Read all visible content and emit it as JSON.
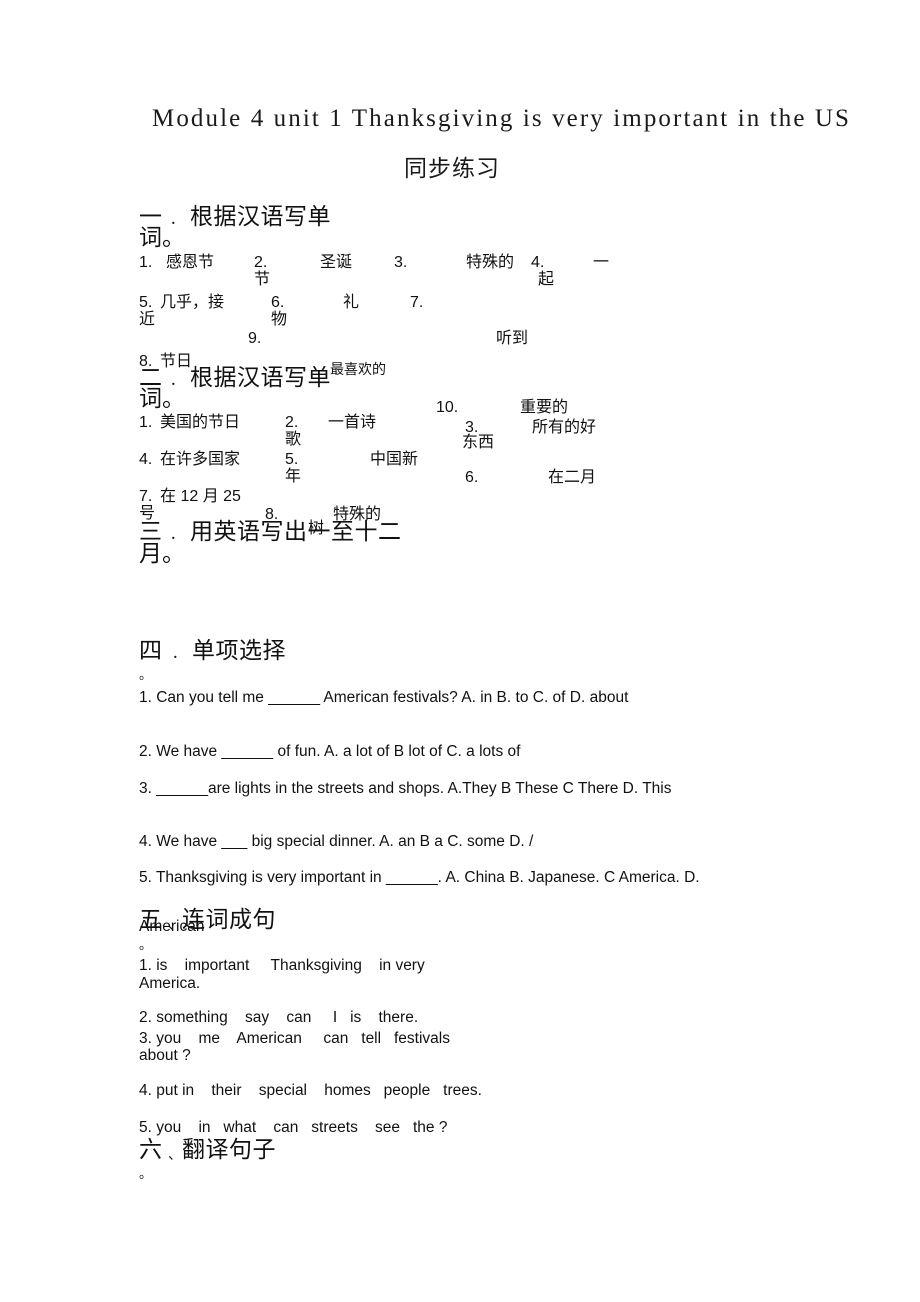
{
  "document": {
    "title": "Module 4 unit 1 Thanksgiving is very important in the US",
    "subtitle": "同步练习"
  },
  "section1": {
    "heading_num": "一",
    "heading_dot": "．",
    "heading_text": "根据汉语写单",
    "heading_wrap": "词。",
    "items": [
      {
        "num": "1.",
        "answer": "感恩节"
      },
      {
        "num": "2.",
        "answer": "圣诞",
        "answer_wrap": "节"
      },
      {
        "num": "3.",
        "answer": "特殊的"
      },
      {
        "num": "4.",
        "answer": "一",
        "answer_wrap": "起"
      },
      {
        "num": "5.",
        "answer": "几乎，接",
        "answer_wrap": "近"
      },
      {
        "num": "6.",
        "answer": "礼",
        "answer_wrap": "物"
      },
      {
        "num": "7.",
        "answer": "听到"
      },
      {
        "num": "8.",
        "answer": "节日"
      },
      {
        "num": "9.",
        "answer": "最喜欢的"
      }
    ]
  },
  "section2": {
    "heading_num": "二",
    "heading_dot": "．",
    "heading_text": "根据汉语写单",
    "heading_wrap": "词。",
    "items": [
      {
        "num": "1.",
        "answer": "美国的节日"
      },
      {
        "num": "2.",
        "answer": "一首诗",
        "answer_wrap": "歌"
      },
      {
        "num": "3.",
        "answer": "所有的好",
        "answer_wrap": "东西"
      },
      {
        "num": "4.",
        "answer": "在许多国家"
      },
      {
        "num": "5.",
        "answer": "中国新",
        "answer_wrap": "年"
      },
      {
        "num": "6.",
        "answer": "在二月"
      },
      {
        "num": "7.",
        "answer": "在 12 月 25",
        "answer_wrap": "号"
      },
      {
        "num": "8.",
        "answer": "特殊的",
        "answer_wrap": "树"
      },
      {
        "num": "10.",
        "answer": "重要的"
      }
    ]
  },
  "section3": {
    "heading_num": "三",
    "heading_dot": "．",
    "heading_text": "用英语写出一至十二",
    "heading_wrap": "月。"
  },
  "section4": {
    "heading_num": "四",
    "heading_dot": "．",
    "heading_text": "单项选择",
    "heading_period": "。",
    "questions": [
      {
        "text": "1.  Can you tell me ______ American festivals? A. in      B. to    C. of    D. about"
      },
      {
        "text": "2. We have ______ of fun. A. a lot of     B lot of    C. a lots of"
      },
      {
        "text": "3. ______are lights in the streets and shops. A.They     B These C There D. This"
      },
      {
        "text": "4. We have ___ big special dinner. A. an B a    C. some    D. /"
      },
      {
        "text": "5. Thanksgiving is very important in ______. A. China      B. Japanese.   C America. D.",
        "wrap": "American"
      }
    ]
  },
  "section5": {
    "heading_num": "五",
    "heading_dot": "、",
    "heading_text": "连词成句",
    "heading_period": "。",
    "items": [
      {
        "text": "1. is    important     Thanksgiving    in very",
        "wrap": "America."
      },
      {
        "text": "2. something    say    can     I   is    there."
      },
      {
        "text": "3. you    me    American     can   tell   festivals",
        "wrap": "about ?"
      },
      {
        "text": "4. put in    their    special    homes   people   trees."
      },
      {
        "text": "5. you    in   what    can   streets    see   the ?"
      }
    ]
  },
  "section6": {
    "heading_num": "六",
    "heading_dot": "、",
    "heading_text": "翻译句子",
    "heading_period": "。"
  }
}
